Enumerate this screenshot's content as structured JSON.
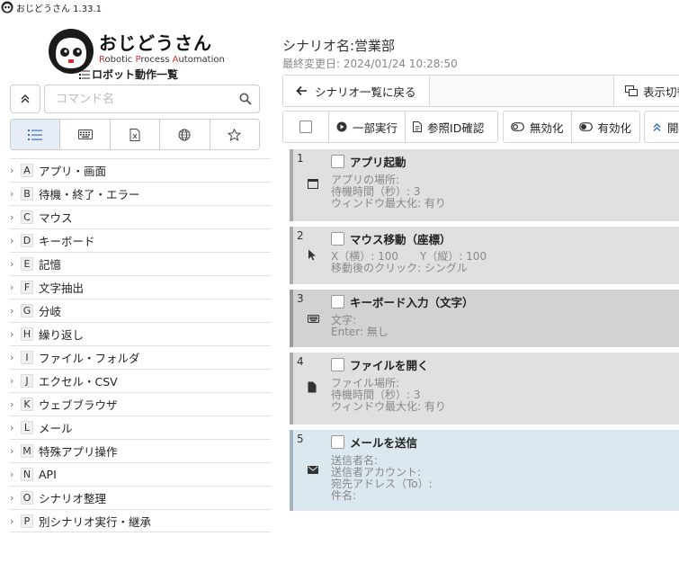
{
  "window": {
    "title": "おじどうさん 1.33.1"
  },
  "sidebar": {
    "logo_name": "おじどうさん",
    "logo_sub_parts": [
      "R",
      "obotic ",
      "P",
      "rocess ",
      "A",
      "utomation"
    ],
    "list_title": "ロボット動作一覧",
    "search_placeholder": "コマンド名",
    "tabs": [
      {
        "icon": "list-icon"
      },
      {
        "icon": "keyboard-icon"
      },
      {
        "icon": "excel-file-icon"
      },
      {
        "icon": "globe-icon"
      },
      {
        "icon": "star-icon"
      }
    ],
    "categories": [
      {
        "letter": "A",
        "label": "アプリ・画面"
      },
      {
        "letter": "B",
        "label": "待機・終了・エラー"
      },
      {
        "letter": "C",
        "label": "マウス"
      },
      {
        "letter": "D",
        "label": "キーボード"
      },
      {
        "letter": "E",
        "label": "記憶"
      },
      {
        "letter": "F",
        "label": "文字抽出"
      },
      {
        "letter": "G",
        "label": "分岐"
      },
      {
        "letter": "H",
        "label": "繰り返し"
      },
      {
        "letter": "I",
        "label": "ファイル・フォルダ"
      },
      {
        "letter": "J",
        "label": "エクセル・CSV"
      },
      {
        "letter": "K",
        "label": "ウェブブラウザ"
      },
      {
        "letter": "L",
        "label": "メール"
      },
      {
        "letter": "M",
        "label": "特殊アプリ操作"
      },
      {
        "letter": "N",
        "label": "API"
      },
      {
        "letter": "O",
        "label": "シナリオ整理"
      },
      {
        "letter": "P",
        "label": "別シナリオ実行・継承"
      }
    ]
  },
  "main": {
    "scenario_name": "シナリオ名:営業部",
    "last_modified": "最終変更日: 2024/01/24 10:28:50",
    "back_label": "シナリオ一覧に戻る",
    "view_toggle_label": "表示切替",
    "toolbar": {
      "partial_run": "一部実行",
      "ref_id_check": "参照ID確認",
      "disable": "無効化",
      "enable": "有効化",
      "open_label": "開"
    },
    "steps": [
      {
        "num": "1",
        "title": "アプリ起動",
        "icon": "window-icon",
        "lines": [
          "アプリの場所:",
          "待機時間（秒）: 3",
          "ウィンドウ最大化: 有り"
        ]
      },
      {
        "num": "2",
        "title": "マウス移動（座標）",
        "icon": "cursor-icon",
        "lines": [
          "X（横）: 100　　Y（縦）: 100",
          "移動後のクリック: シングル"
        ]
      },
      {
        "num": "3",
        "title": "キーボード入力（文字）",
        "icon": "keyboard-icon",
        "lines": [
          "文字:",
          "Enter: 無し"
        ]
      },
      {
        "num": "4",
        "title": "ファイルを開く",
        "icon": "file-icon",
        "lines": [
          "ファイル場所:",
          "待機時間（秒）: 3",
          "ウィンドウ最大化: 有り"
        ]
      },
      {
        "num": "5",
        "title": "メールを送信",
        "icon": "mail-icon",
        "lines": [
          "送信者名:",
          "送信者アカウント:",
          "宛先アドレス（To）:",
          "件名:"
        ]
      }
    ]
  }
}
